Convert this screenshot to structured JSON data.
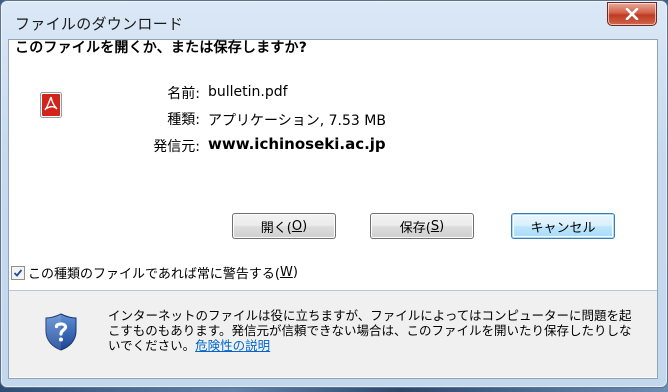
{
  "window": {
    "title": "ファイルのダウンロード"
  },
  "dialog": {
    "question": "このファイルを開くか、または保存しますか?",
    "file_icon": "pdf-icon",
    "info": {
      "name_label": "名前:",
      "name_value": "bulletin.pdf",
      "type_label": "種類:",
      "type_value": "アプリケーション, 7.53 MB",
      "from_label": "発信元:",
      "from_value": "www.ichinoseki.ac.jp"
    },
    "buttons": {
      "open_text": "開く(",
      "open_key": "O",
      "save_text": "保存(",
      "save_key": "S",
      "cancel": "キャンセル",
      "close_paren": ")"
    },
    "checkbox": {
      "checked": true,
      "label": "この種類のファイルであれば常に警告する(",
      "key": "W",
      "label_end": ")"
    },
    "footer": {
      "icon": "shield-question-icon",
      "text": "インターネットのファイルは役に立ちますが、ファイルによってはコンピューターに問題を起こすものもあります。発信元が信頼できない場合は、このファイルを開いたり保存したりしないでください。",
      "link": "危険性の説明"
    }
  },
  "colors": {
    "link": "#0066cc",
    "close_button": "#c7492f",
    "default_button_border": "#3c7fb1"
  }
}
